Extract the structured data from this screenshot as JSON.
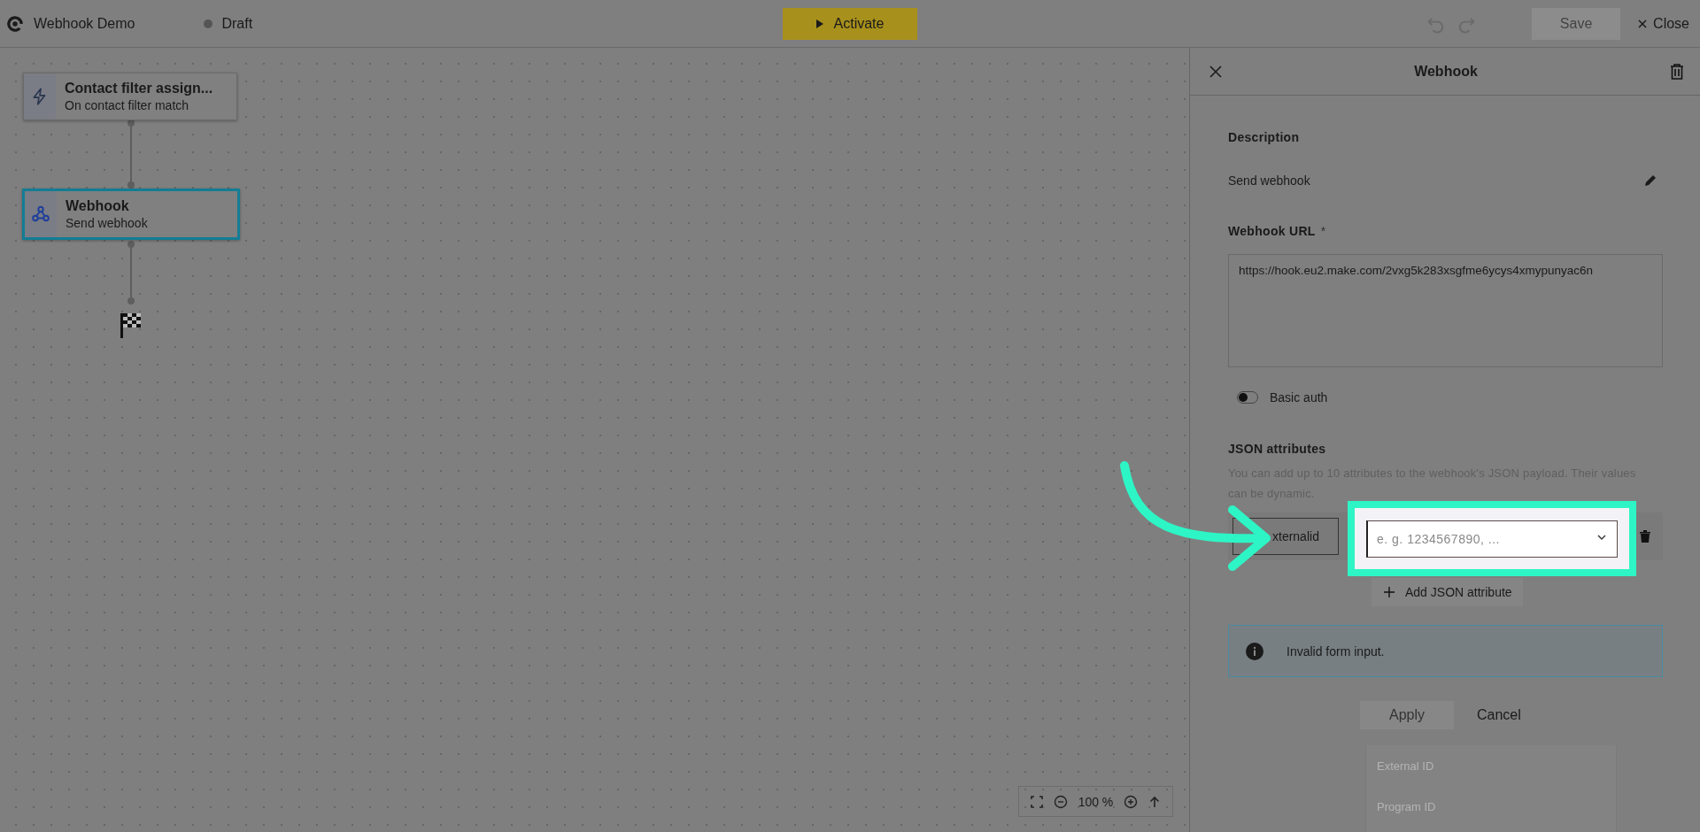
{
  "topbar": {
    "title": "Webhook Demo",
    "status": "Draft",
    "activate_button": "Activate",
    "save_button": "Save",
    "close_button": "Close"
  },
  "canvas": {
    "nodes": [
      {
        "kind": "trigger",
        "title": "Contact filter assign...",
        "subtitle": "On contact filter match",
        "selected": false
      },
      {
        "kind": "webhook",
        "title": "Webhook",
        "subtitle": "Send webhook",
        "selected": true
      }
    ],
    "zoom_level": "100 %"
  },
  "panel": {
    "title": "Webhook",
    "description_label": "Description",
    "description": "Send webhook",
    "url_label": "Webhook URL",
    "url_required_mark": "*",
    "url": "https://hook.eu2.make.com/2vxg5k283xsgfme6ycys4xmypunyac6n",
    "basic_auth": {
      "label": "Basic auth",
      "on": false
    },
    "json_label": "JSON attributes",
    "json_help": "You can add up to 10 attributes to the webhook's JSON payload. Their values can be dynamic.",
    "attributes": [
      {
        "key": "xternalid",
        "value_placeholder": "e. g. 1234567890, ..."
      }
    ],
    "add_button": "Add JSON attribute",
    "alert": "Invalid form input.",
    "apply_button": "Apply",
    "cancel_button": "Cancel"
  },
  "dropdown": {
    "options": [
      "External ID",
      "Program ID"
    ]
  }
}
